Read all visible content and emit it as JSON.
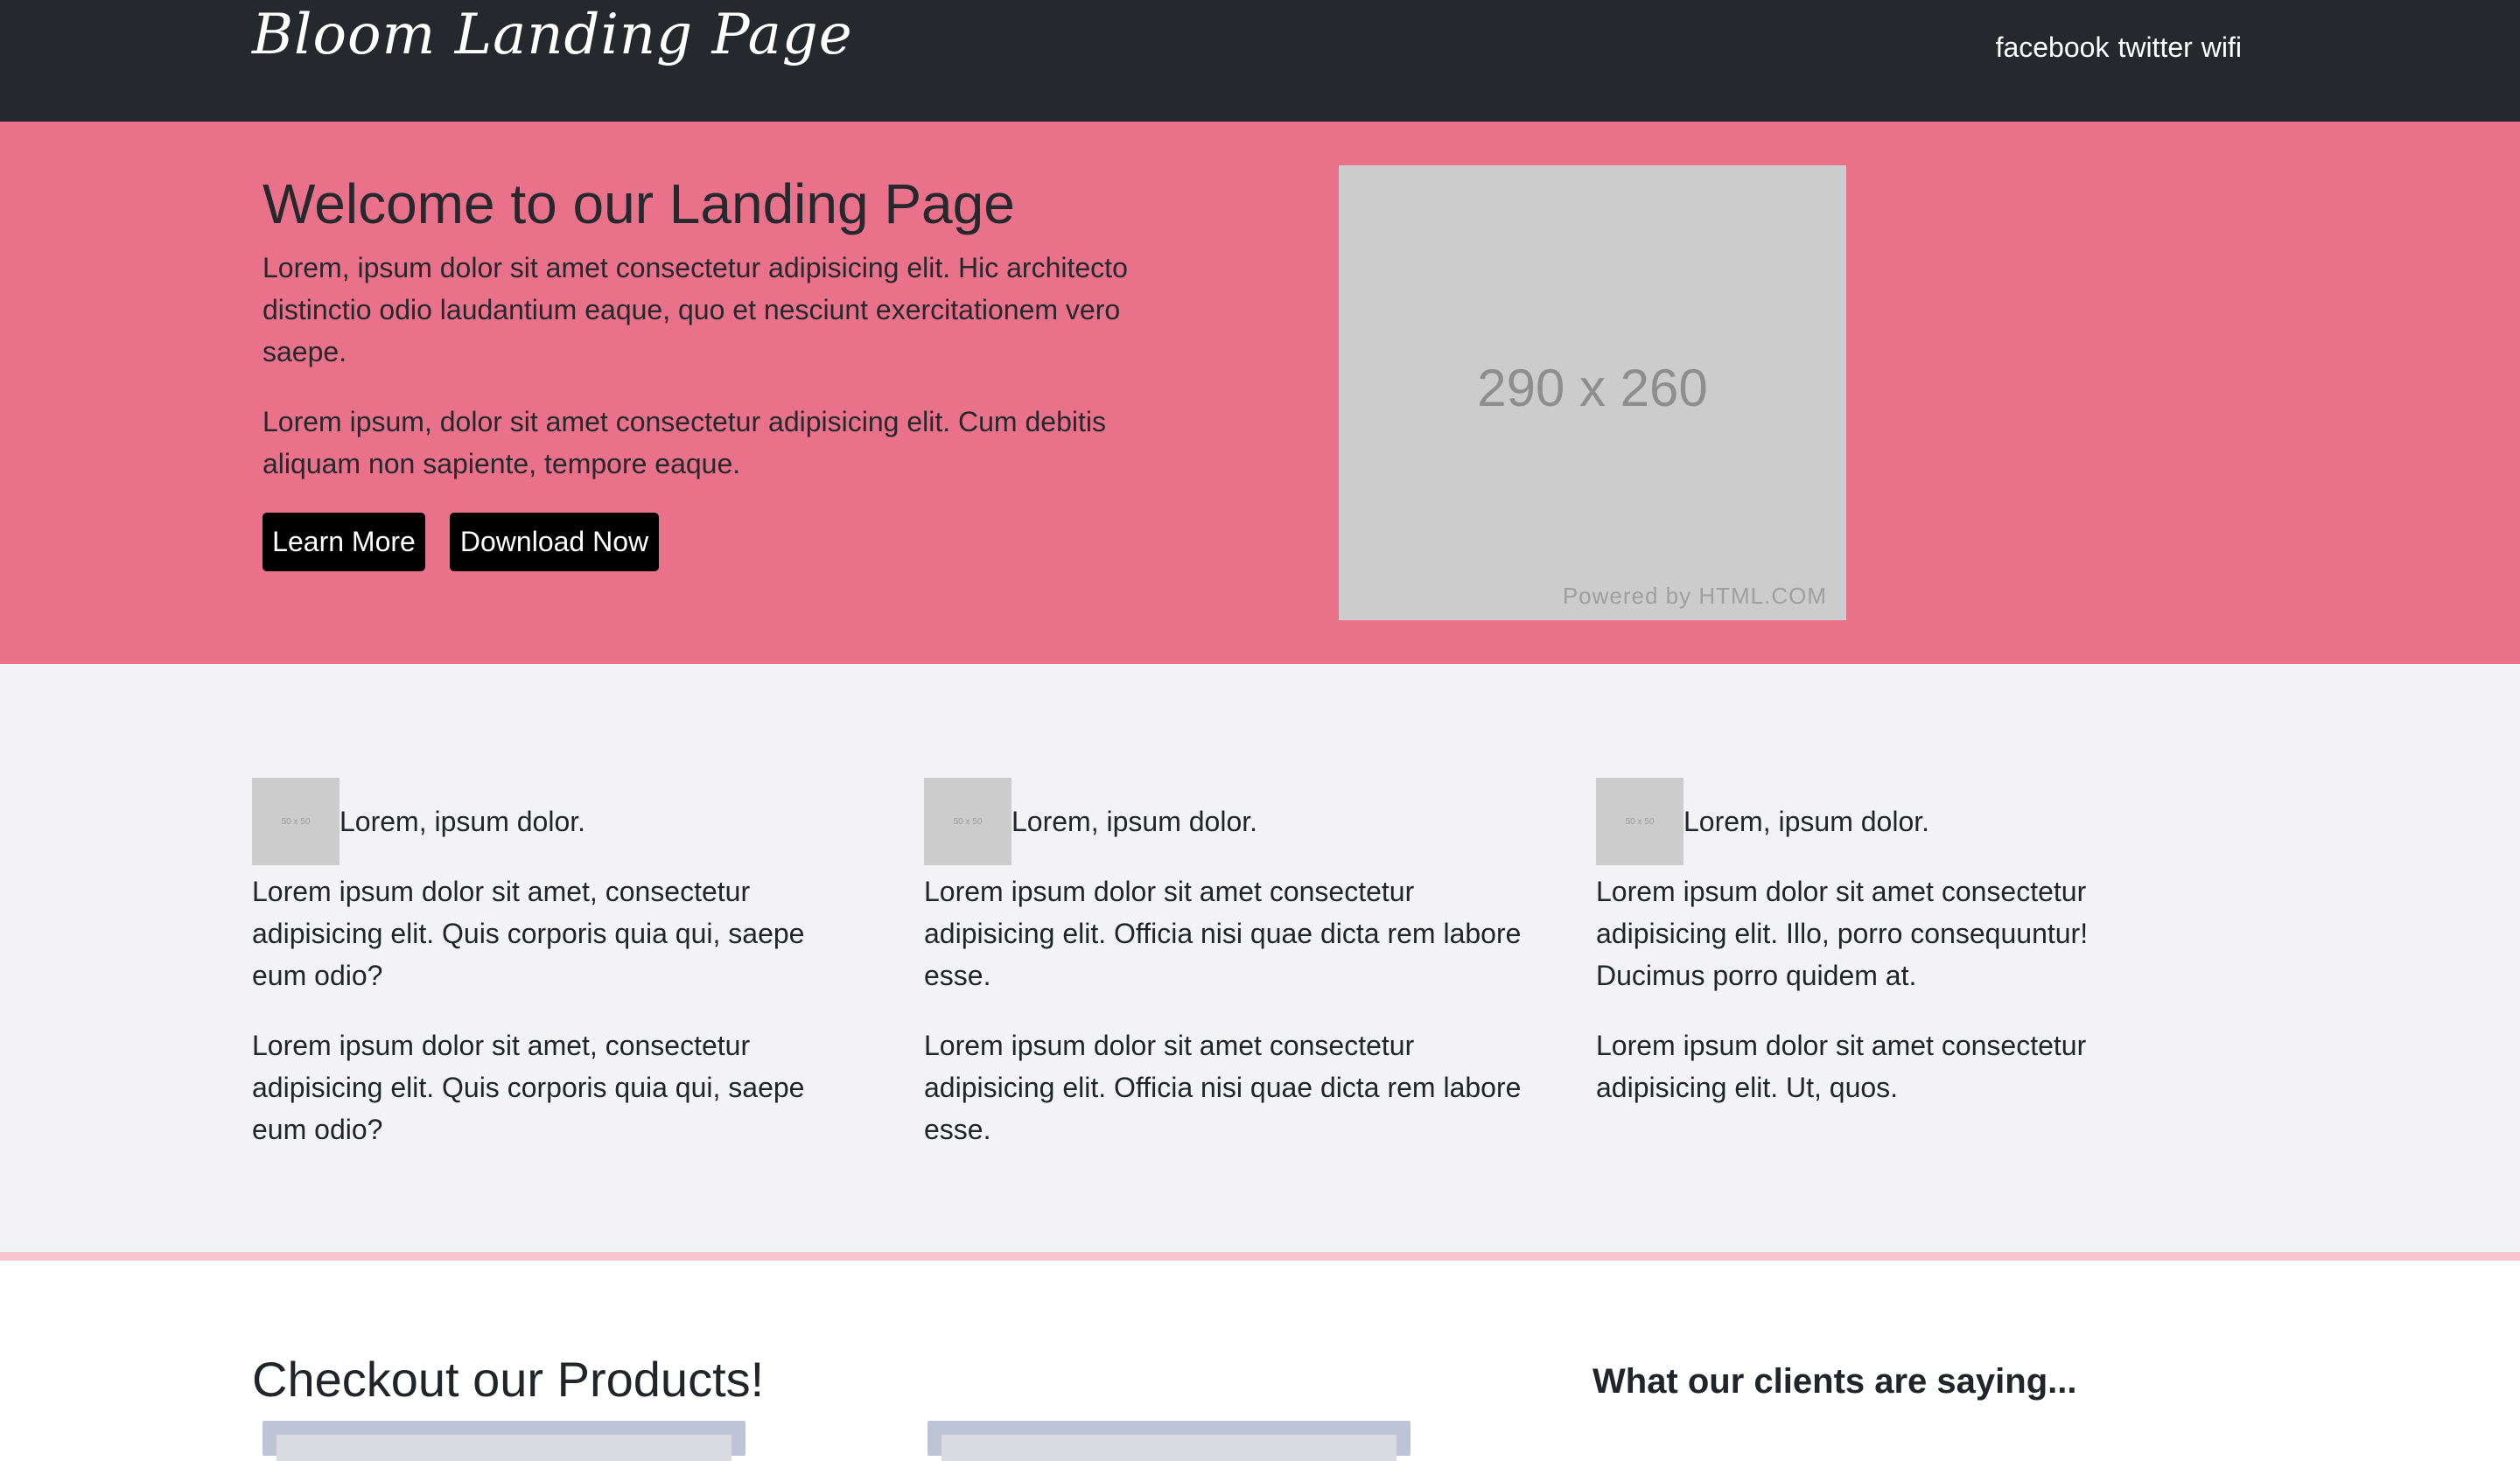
{
  "header": {
    "brand": "Bloom Landing Page",
    "social": [
      "facebook",
      "twitter",
      "wifi"
    ],
    "background": "#25282d"
  },
  "hero": {
    "title": "Welcome to our Landing Page",
    "paragraphs": [
      "Lorem, ipsum dolor sit amet consectetur adipisicing elit. Hic architecto distinctio odio laudantium eaque, quo et nesciunt exercitationem vero saepe.",
      "Lorem ipsum, dolor sit amet consectetur adipisicing elit. Cum debitis aliquam non sapiente, tempore eaque."
    ],
    "buttons": {
      "learn_more": "Learn More",
      "download_now": "Download Now"
    },
    "image": {
      "dimensions_label": "290 x 260",
      "credit": "Powered by HTML.COM"
    },
    "background": "#e9718a"
  },
  "features": [
    {
      "thumb_label": "50 x 50",
      "title": "Lorem, ipsum dolor.",
      "paragraphs": [
        "Lorem ipsum dolor sit amet, consectetur adipisicing elit. Quis corporis quia qui, saepe eum odio?",
        "Lorem ipsum dolor sit amet, consectetur adipisicing elit. Quis corporis quia qui, saepe eum odio?"
      ]
    },
    {
      "thumb_label": "50 x 50",
      "title": "Lorem, ipsum dolor.",
      "paragraphs": [
        "Lorem ipsum dolor sit amet consectetur adipisicing elit. Officia nisi quae dicta rem labore esse.",
        "Lorem ipsum dolor sit amet consectetur adipisicing elit. Officia nisi quae dicta rem labore esse."
      ]
    },
    {
      "thumb_label": "50 x 50",
      "title": "Lorem, ipsum dolor.",
      "paragraphs": [
        "Lorem ipsum dolor sit amet consectetur adipisicing elit. Illo, porro consequuntur! Ducimus porro quidem at.",
        "Lorem ipsum dolor sit amet consectetur adipisicing elit. Ut, quos."
      ]
    }
  ],
  "products": {
    "title": "Checkout our Products!"
  },
  "testimonials": {
    "title": "What our clients are saying..."
  },
  "colors": {
    "accent_pink": "#e9718a",
    "divider_pink": "#f6c4cc",
    "features_bg": "#f3f3f5",
    "button_bg": "#000000"
  }
}
